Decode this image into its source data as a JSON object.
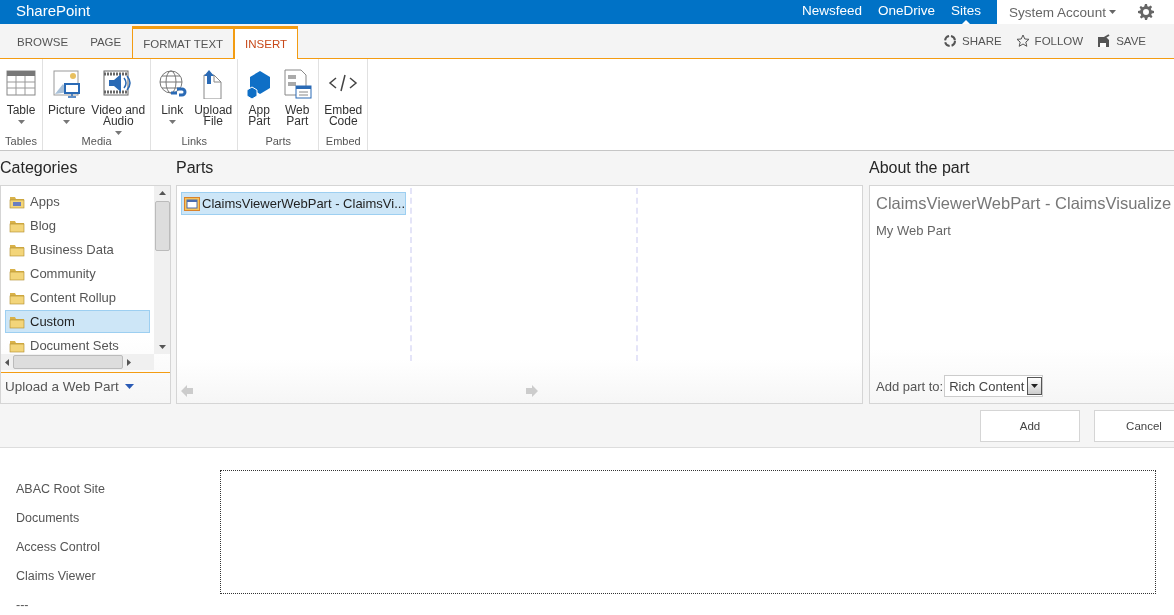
{
  "top_bar": {
    "brand": "SharePoint",
    "links": [
      {
        "label": "Newsfeed",
        "selected": false
      },
      {
        "label": "OneDrive",
        "selected": false
      },
      {
        "label": "Sites",
        "selected": true
      }
    ],
    "account": "System Account"
  },
  "ribbon": {
    "tabs": [
      {
        "label": "BROWSE",
        "selected": false,
        "contextual": false
      },
      {
        "label": "PAGE",
        "selected": false,
        "contextual": false
      },
      {
        "label": "FORMAT TEXT",
        "selected": false,
        "contextual": true
      },
      {
        "label": "INSERT",
        "selected": true,
        "contextual": true
      }
    ],
    "actions": [
      {
        "label": "SHARE",
        "kind": "share"
      },
      {
        "label": "FOLLOW",
        "kind": "follow"
      },
      {
        "label": "SAVE",
        "kind": "save"
      }
    ],
    "groups": [
      {
        "label": "Tables",
        "buttons": [
          {
            "label": "Table",
            "kind": "table",
            "dropdown": true
          }
        ]
      },
      {
        "label": "Media",
        "buttons": [
          {
            "label": "Picture",
            "kind": "picture",
            "dropdown": true
          },
          {
            "label": "Video and\nAudio",
            "kind": "video",
            "dropdown": true
          }
        ]
      },
      {
        "label": "Links",
        "buttons": [
          {
            "label": "Link",
            "kind": "link",
            "dropdown": true
          },
          {
            "label": "Upload\nFile",
            "kind": "upload",
            "dropdown": false
          }
        ]
      },
      {
        "label": "Parts",
        "buttons": [
          {
            "label": "App\nPart",
            "kind": "app",
            "dropdown": false
          },
          {
            "label": "Web\nPart",
            "kind": "webpart",
            "dropdown": false
          }
        ]
      },
      {
        "label": "Embed",
        "buttons": [
          {
            "label": "Embed\nCode",
            "kind": "embed",
            "dropdown": false
          }
        ]
      }
    ]
  },
  "categories": {
    "title": "Categories",
    "items": [
      {
        "label": "Apps",
        "kind": "apps",
        "selected": false
      },
      {
        "label": "Blog",
        "kind": "folder",
        "selected": false
      },
      {
        "label": "Business Data",
        "kind": "folder",
        "selected": false
      },
      {
        "label": "Community",
        "kind": "folder",
        "selected": false
      },
      {
        "label": "Content Rollup",
        "kind": "folder",
        "selected": false
      },
      {
        "label": "Custom",
        "kind": "folder",
        "selected": true
      },
      {
        "label": "Document Sets",
        "kind": "folder",
        "selected": false
      }
    ],
    "upload_link": "Upload a Web Part"
  },
  "parts": {
    "title": "Parts",
    "items": [
      {
        "label": "ClaimsViewerWebPart - ClaimsVi...",
        "selected": true
      }
    ]
  },
  "about": {
    "title": "About the part",
    "part_name": "ClaimsViewerWebPart - ClaimsVisualize",
    "description": "My Web Part",
    "add_to_label": "Add part to:",
    "zone": "Rich Content"
  },
  "buttons": [
    "Add",
    "Cancel"
  ],
  "quick_launch": [
    "ABAC Root Site",
    "Documents",
    "Access Control",
    "Claims Viewer",
    "---"
  ]
}
